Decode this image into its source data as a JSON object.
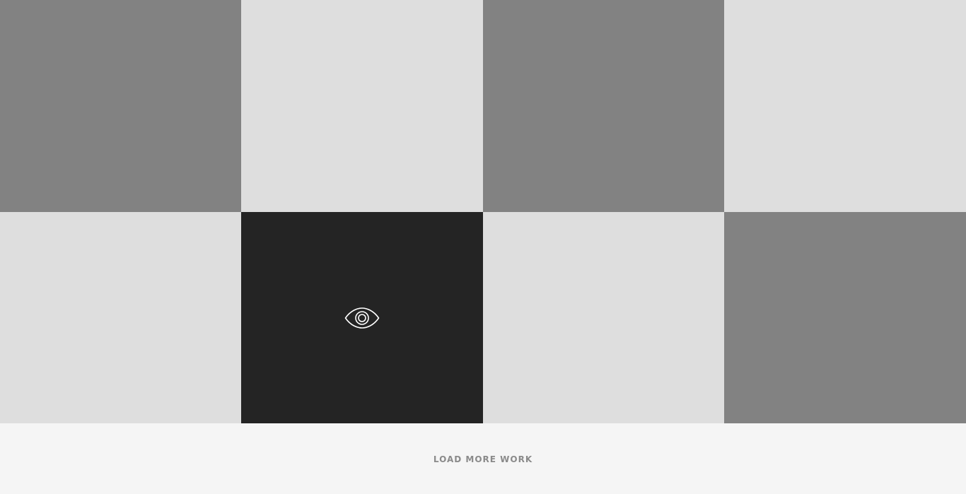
{
  "portfolio": {
    "tiles": [
      {
        "row": 1,
        "col": 1,
        "shade": "dark",
        "color": "#828282"
      },
      {
        "row": 1,
        "col": 2,
        "shade": "light",
        "color": "#dedede"
      },
      {
        "row": 1,
        "col": 3,
        "shade": "dark",
        "color": "#828282"
      },
      {
        "row": 1,
        "col": 4,
        "shade": "light",
        "color": "#dedede"
      },
      {
        "row": 2,
        "col": 1,
        "shade": "light",
        "color": "#dedede"
      },
      {
        "row": 2,
        "col": 2,
        "shade": "hovered",
        "color": "#242424",
        "overlay_icon": "eye-icon"
      },
      {
        "row": 2,
        "col": 3,
        "shade": "light",
        "color": "#dedede"
      },
      {
        "row": 2,
        "col": 4,
        "shade": "dark",
        "color": "#828282"
      }
    ]
  },
  "footer": {
    "load_more_label": "LOAD MORE WORK",
    "background": "#f5f5f5",
    "text_color": "#8a8a8a"
  }
}
